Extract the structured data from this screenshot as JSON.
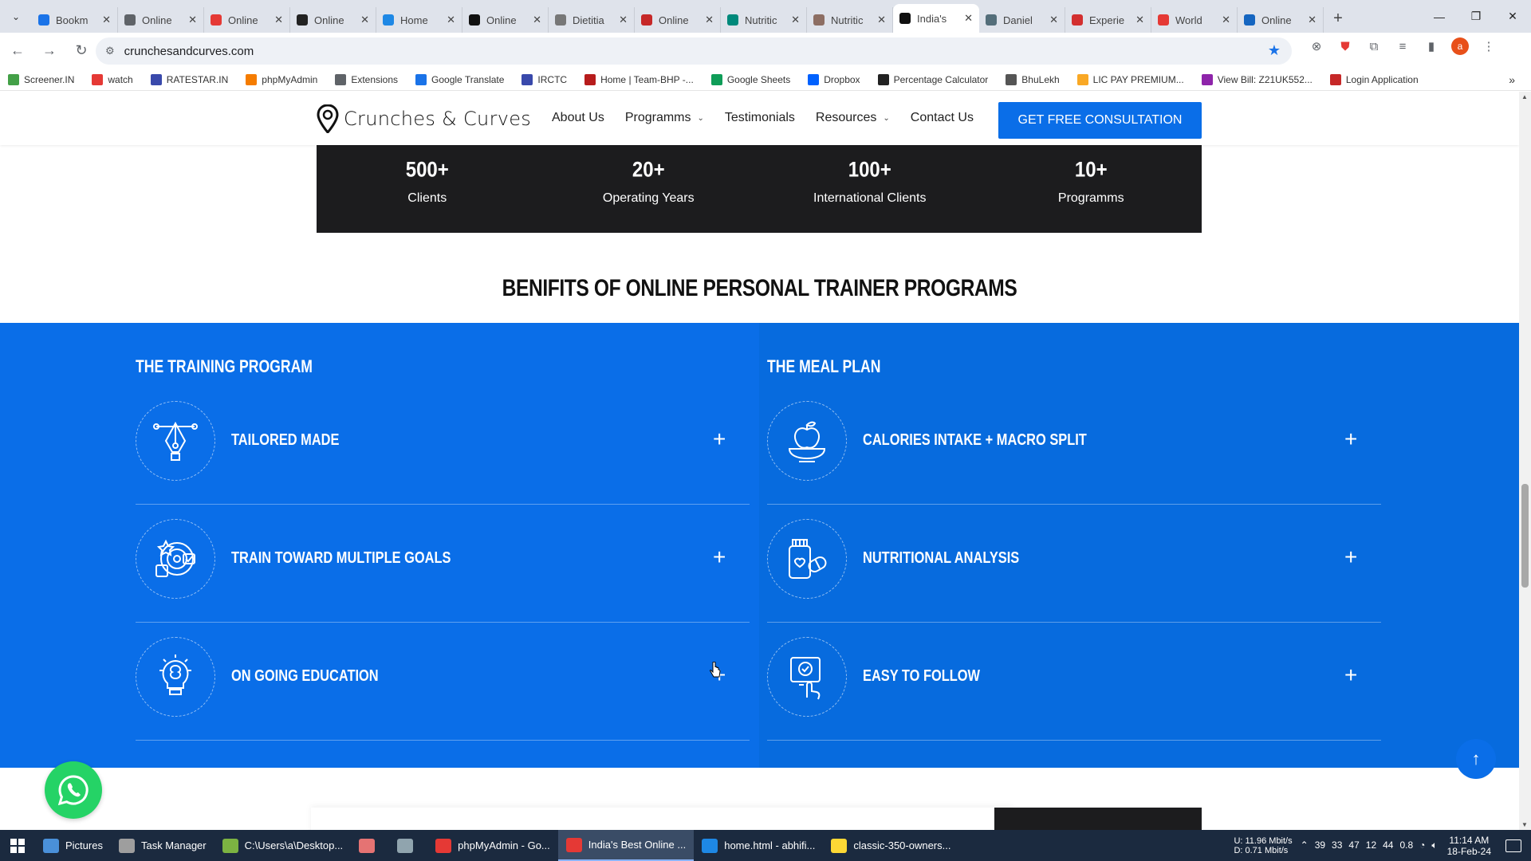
{
  "browser": {
    "tabs": [
      {
        "label": "Bookm",
        "color": "#1a73e8",
        "active": false
      },
      {
        "label": "Online",
        "color": "#5f6368",
        "active": false
      },
      {
        "label": "Online",
        "color": "#e53935",
        "active": false
      },
      {
        "label": "Online",
        "color": "#222222",
        "active": false
      },
      {
        "label": "Home",
        "color": "#1e88e5",
        "active": false
      },
      {
        "label": "Online",
        "color": "#111111",
        "active": false
      },
      {
        "label": "Dietitia",
        "color": "#777777",
        "active": false
      },
      {
        "label": "Online",
        "color": "#c62828",
        "active": false
      },
      {
        "label": "Nutritic",
        "color": "#00897b",
        "active": false
      },
      {
        "label": "Nutritic",
        "color": "#8d6e63",
        "active": false
      },
      {
        "label": "India's",
        "color": "#111111",
        "active": true
      },
      {
        "label": "Daniel",
        "color": "#546e7a",
        "active": false
      },
      {
        "label": "Experie",
        "color": "#d32f2f",
        "active": false
      },
      {
        "label": "World",
        "color": "#e53935",
        "active": false
      },
      {
        "label": "Online",
        "color": "#1565c0",
        "active": false
      }
    ],
    "url": "crunchesandcurves.com",
    "bookmarks": [
      {
        "label": "Screener.IN",
        "color": "#43a047"
      },
      {
        "label": "watch",
        "color": "#e53935"
      },
      {
        "label": "RATESTAR.IN",
        "color": "#3949ab"
      },
      {
        "label": "phpMyAdmin",
        "color": "#f57c00"
      },
      {
        "label": "Extensions",
        "color": "#5f6368"
      },
      {
        "label": "Google Translate",
        "color": "#1a73e8"
      },
      {
        "label": "IRCTC",
        "color": "#3949ab"
      },
      {
        "label": "Home | Team-BHP -...",
        "color": "#b71c1c"
      },
      {
        "label": "Google Sheets",
        "color": "#0f9d58"
      },
      {
        "label": "Dropbox",
        "color": "#0061fe"
      },
      {
        "label": "Percentage Calculator",
        "color": "#222222"
      },
      {
        "label": "BhuLekh",
        "color": "#555555"
      },
      {
        "label": "LIC PAY PREMIUM...",
        "color": "#f9a825"
      },
      {
        "label": "View Bill: Z21UK552...",
        "color": "#8e24aa"
      },
      {
        "label": "Login Application",
        "color": "#c62828"
      }
    ]
  },
  "site": {
    "logo_text": "Crunches & Curves",
    "nav": {
      "about": "About Us",
      "programs": "Programms",
      "testimonials": "Testimonials",
      "resources": "Resources",
      "contact": "Contact Us"
    },
    "cta": "GET FREE CONSULTATION",
    "stats": [
      {
        "num": "500+",
        "label": "Clients"
      },
      {
        "num": "20+",
        "label": "Operating Years"
      },
      {
        "num": "100+",
        "label": "International Clients"
      },
      {
        "num": "10+",
        "label": "Programms"
      }
    ],
    "benefits_title": "BENIFITS OF ONLINE PERSONAL TRAINER PROGRAMS",
    "training": {
      "title": "THE TRAINING PROGRAM",
      "items": [
        {
          "label": "TAILORED MADE",
          "icon": "pen-nib-icon"
        },
        {
          "label": "TRAIN TOWARD MULTIPLE GOALS",
          "icon": "target-goals-icon"
        },
        {
          "label": "ON GOING EDUCATION",
          "icon": "lightbulb-brain-icon"
        }
      ]
    },
    "meal": {
      "title": "THE MEAL PLAN",
      "items": [
        {
          "label": "CALORIES INTAKE + MACRO SPLIT",
          "icon": "apple-bowl-icon"
        },
        {
          "label": "NUTRITIONAL ANALYSIS",
          "icon": "pills-bottle-icon"
        },
        {
          "label": "EASY TO FOLLOW",
          "icon": "touch-screen-check-icon"
        }
      ]
    },
    "plus": "+",
    "scroll_top": "↑"
  },
  "taskbar": {
    "items": [
      {
        "label": "Pictures",
        "color": "#4a90d9"
      },
      {
        "label": "Task Manager",
        "color": "#9e9e9e"
      },
      {
        "label": "C:\\Users\\a\\Desktop...",
        "color": "#7cb342"
      },
      {
        "label": "",
        "color": "#e57373"
      },
      {
        "label": "",
        "color": "#90a4ae"
      },
      {
        "label": "phpMyAdmin - Go...",
        "color": "#e53935"
      },
      {
        "label": "India's Best Online ...",
        "color": "#e53935"
      },
      {
        "label": "home.html - abhifi...",
        "color": "#1e88e5"
      },
      {
        "label": "classic-350-owners...",
        "color": "#fdd835"
      }
    ],
    "net_up": "U:   11.96 Mbit/s",
    "net_down": "D:   0.71 Mbit/s",
    "tray_numbers": [
      "39",
      "33",
      "47",
      "12",
      "44",
      "0.8"
    ],
    "time": "11:14 AM",
    "date": "18-Feb-24"
  }
}
